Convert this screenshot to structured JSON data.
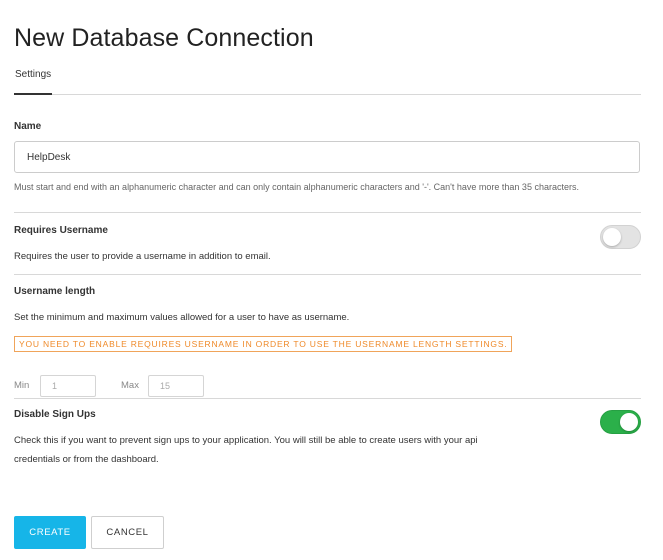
{
  "page": {
    "title": "New Database Connection"
  },
  "tabs": [
    {
      "label": "Settings",
      "active": true
    }
  ],
  "name_field": {
    "label": "Name",
    "value": "HelpDesk",
    "help": "Must start and end with an alphanumeric character and can only contain alphanumeric characters and '-'. Can't have more than 35 characters."
  },
  "requires_username": {
    "label": "Requires Username",
    "description": "Requires the user to provide a username in addition to email.",
    "enabled": false
  },
  "username_length": {
    "label": "Username length",
    "description": "Set the minimum and maximum values allowed for a user to have as username.",
    "warning": "YOU NEED TO ENABLE REQUIRES USERNAME IN ORDER TO USE THE USERNAME LENGTH SETTINGS.",
    "min_label": "Min",
    "min_placeholder": "1",
    "max_label": "Max",
    "max_placeholder": "15"
  },
  "disable_signups": {
    "label": "Disable Sign Ups",
    "description": "Check this if you want to prevent sign ups to your application. You will still be able to create users with your api credentials or from the dashboard.",
    "enabled": true
  },
  "actions": {
    "create_label": "CREATE",
    "cancel_label": "CANCEL"
  },
  "colors": {
    "primary": "#16b5e8",
    "toggle_on": "#2bb04a",
    "warning": "#ef8a2a"
  }
}
